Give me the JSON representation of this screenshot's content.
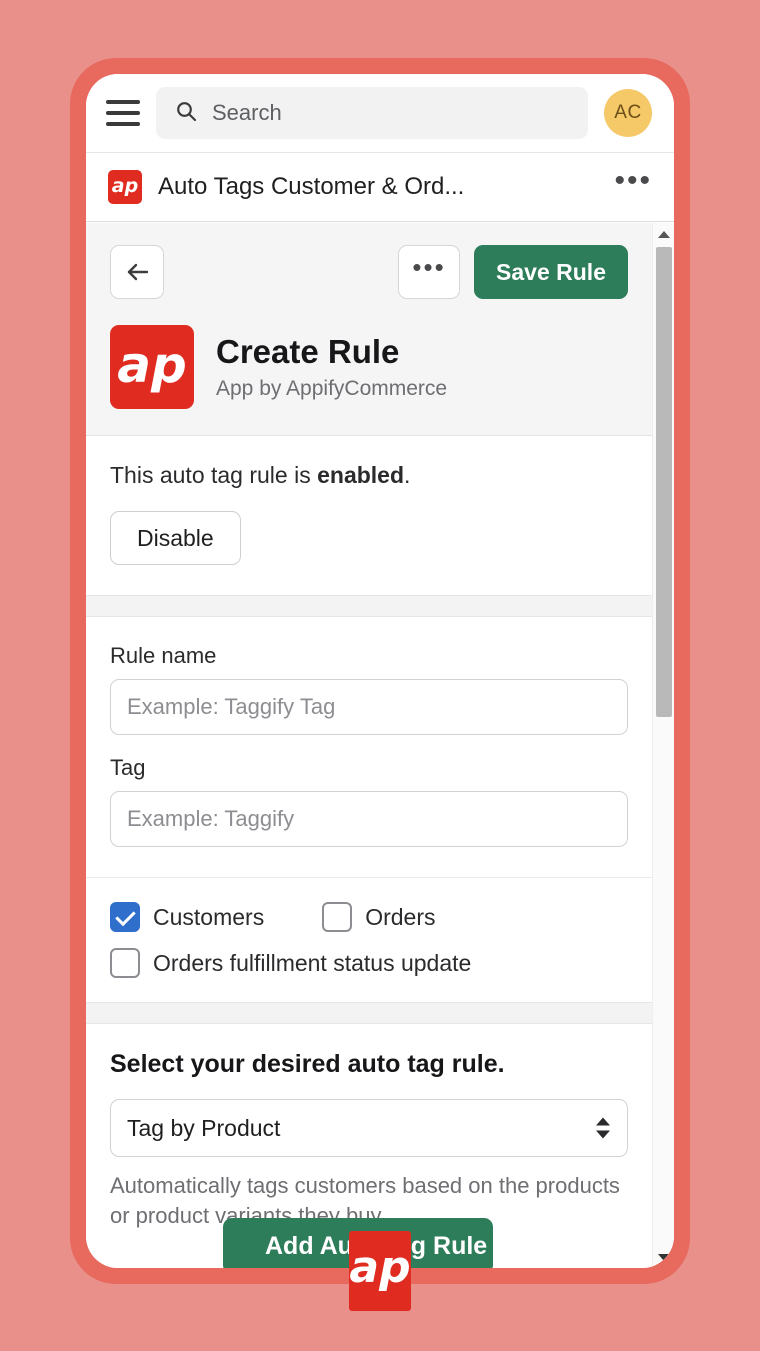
{
  "theme": {
    "bg": "#e89089",
    "frame": "#e8695e",
    "brand_red": "#e02b20",
    "brand_green": "#2e7d5a",
    "checkbox_blue": "#2f6ecb",
    "avatar_bg": "#f5c868"
  },
  "topbar": {
    "menu_icon": "hamburger-icon",
    "search": {
      "icon": "search-icon",
      "placeholder": "Search",
      "value": ""
    },
    "avatar_initials": "AC"
  },
  "appbar": {
    "logo_text": "ap",
    "title": "Auto Tags Customer & Ord...",
    "menu_label": "•••"
  },
  "page_header": {
    "back_label": "←",
    "more_label": "•••",
    "save_label": "Save Rule",
    "logo_text": "ap",
    "title": "Create Rule",
    "subtitle": "App by AppifyCommerce"
  },
  "status_section": {
    "text_prefix": "This auto tag rule is ",
    "state": "enabled",
    "text_suffix": ".",
    "disable_label": "Disable"
  },
  "form": {
    "rule_name": {
      "label": "Rule name",
      "placeholder": "Example: Taggify Tag",
      "value": ""
    },
    "tag": {
      "label": "Tag",
      "placeholder": "Example: Taggify",
      "value": ""
    }
  },
  "checkboxes": [
    {
      "label": "Customers",
      "checked": true
    },
    {
      "label": "Orders",
      "checked": false
    },
    {
      "label": "Orders fulfillment status update",
      "checked": false
    }
  ],
  "rule_select": {
    "heading": "Select your desired auto tag rule.",
    "selected": "Tag by Product",
    "options": [
      "Tag by Product"
    ],
    "help": "Automatically tags customers based on the products or product variants they buy."
  },
  "bottom": {
    "add_rule_label": "Add Auto Tag Rule",
    "badge_text": "ap"
  },
  "scrollbar": {
    "up_label": "▲",
    "down_label": "▼"
  }
}
